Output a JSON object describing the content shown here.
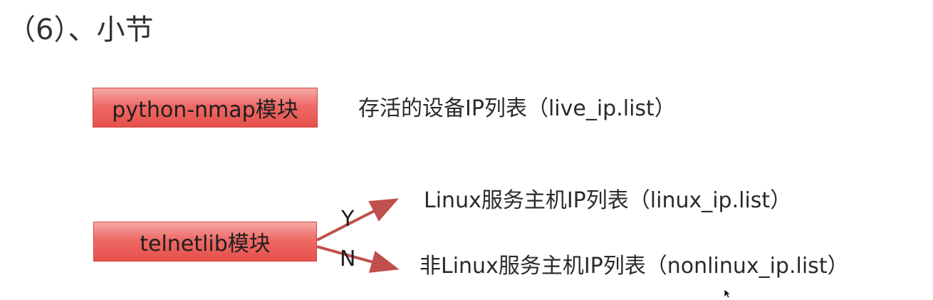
{
  "slide": {
    "title": "（6）、小节"
  },
  "flow": {
    "nmap_box": {
      "label": "python-nmap模块",
      "output": "存活的设备IP列表（live_ip.list）"
    },
    "telnet_box": {
      "label": "telnetlib模块",
      "branches": [
        {
          "label": "Y",
          "output": "Linux服务主机IP列表（linux_ip.list）"
        },
        {
          "label": "N",
          "output": "非Linux服务主机IP列表（nonlinux_ip.list）"
        }
      ]
    }
  },
  "colors": {
    "box_top": "#f6a9a6",
    "box_bottom": "#e6504c",
    "arrow": "#c0504d",
    "text": "#2a2a2a"
  },
  "icons": {
    "cursor": "mouse-pointer-icon"
  }
}
